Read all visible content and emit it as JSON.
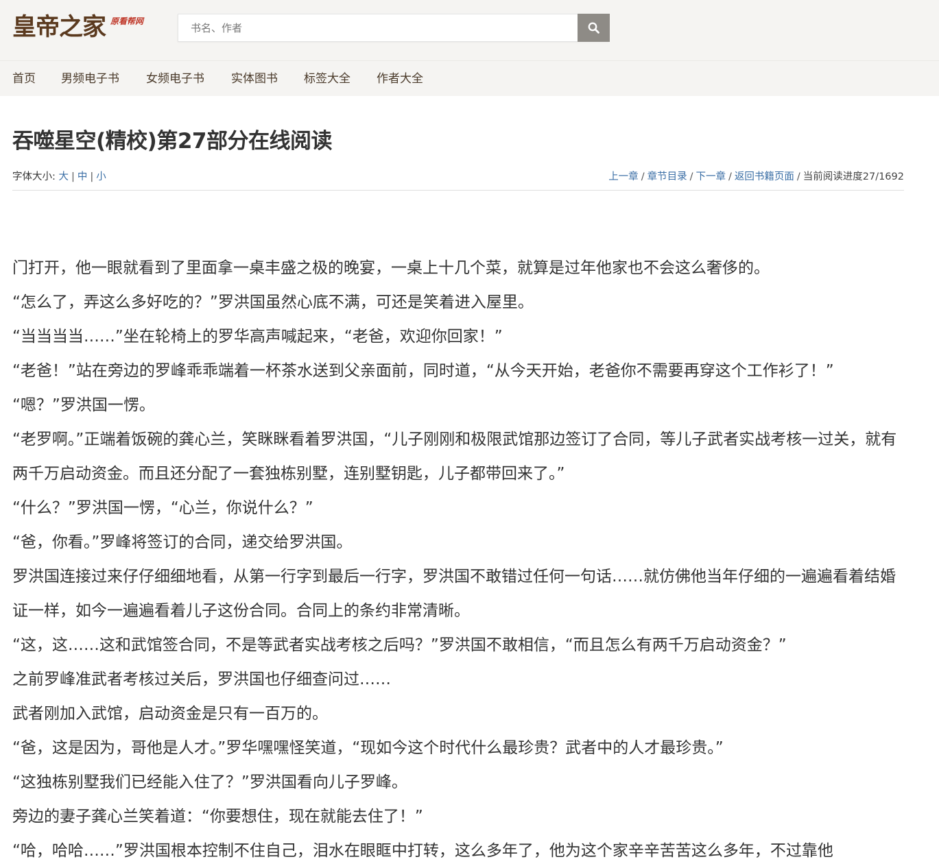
{
  "header": {
    "logo_main": "皇帝之家",
    "logo_sub": "原看帮网",
    "search_placeholder": "书名、作者"
  },
  "nav": {
    "items": [
      {
        "label": "首页"
      },
      {
        "label": "男频电子书"
      },
      {
        "label": "女频电子书"
      },
      {
        "label": "实体图书"
      },
      {
        "label": "标签大全"
      },
      {
        "label": "作者大全"
      }
    ]
  },
  "page": {
    "title": "吞噬星空(精校)第27部分在线阅读"
  },
  "toolbar": {
    "font_size_label": "字体大小:",
    "size_large": "大",
    "size_medium": "中",
    "size_small": "小",
    "prev_chapter": "上一章",
    "toc": "章节目录",
    "next_chapter": "下一章",
    "back_to_book": "返回书籍页面",
    "progress": "当前阅读进度27/1692"
  },
  "content": {
    "paragraphs": [
      "门打开，他一眼就看到了里面拿一桌丰盛之极的晚宴，一桌上十几个菜，就算是过年他家也不会这么奢侈的。",
      "“怎么了，弄这么多好吃的？”罗洪国虽然心底不满，可还是笑着进入屋里。",
      "“当当当当……”坐在轮椅上的罗华高声喊起来，“老爸，欢迎你回家！”",
      "“老爸！”站在旁边的罗峰乖乖端着一杯茶水送到父亲面前，同时道，“从今天开始，老爸你不需要再穿这个工作衫了！”",
      "“嗯？”罗洪国一愣。",
      "“老罗啊。”正端着饭碗的龚心兰，笑眯眯看着罗洪国，“儿子刚刚和极限武馆那边签订了合同，等儿子武者实战考核一过关，就有两千万启动资金。而且还分配了一套独栋别墅，连别墅钥匙，儿子都带回来了。”",
      "“什么？”罗洪国一愣，“心兰，你说什么？”",
      "“爸，你看。”罗峰将签订的合同，递交给罗洪国。",
      "罗洪国连接过来仔仔细细地看，从第一行字到最后一行字，罗洪国不敢错过任何一句话……就仿佛他当年仔细的一遍遍看着结婚证一样，如今一遍遍看着儿子这份合同。合同上的条约非常清晰。",
      "“这，这……这和武馆签合同，不是等武者实战考核之后吗？”罗洪国不敢相信，“而且怎么有两千万启动资金？”",
      "之前罗峰准武者考核过关后，罗洪国也仔细查问过……",
      "武者刚加入武馆，启动资金是只有一百万的。",
      "“爸，这是因为，哥他是人才。”罗华嘿嘿怪笑道，“现如今这个时代什么最珍贵？武者中的人才最珍贵。”",
      "“这独栋别墅我们已经能入住了？”罗洪国看向儿子罗峰。",
      "旁边的妻子龚心兰笑着道：“你要想住，现在就能去住了！”",
      "“哈，哈哈……”罗洪国根本控制不住自己，泪水在眼眶中打转，这么多年了，他为这个家辛辛苦苦这么多年，不过靠他"
    ]
  }
}
